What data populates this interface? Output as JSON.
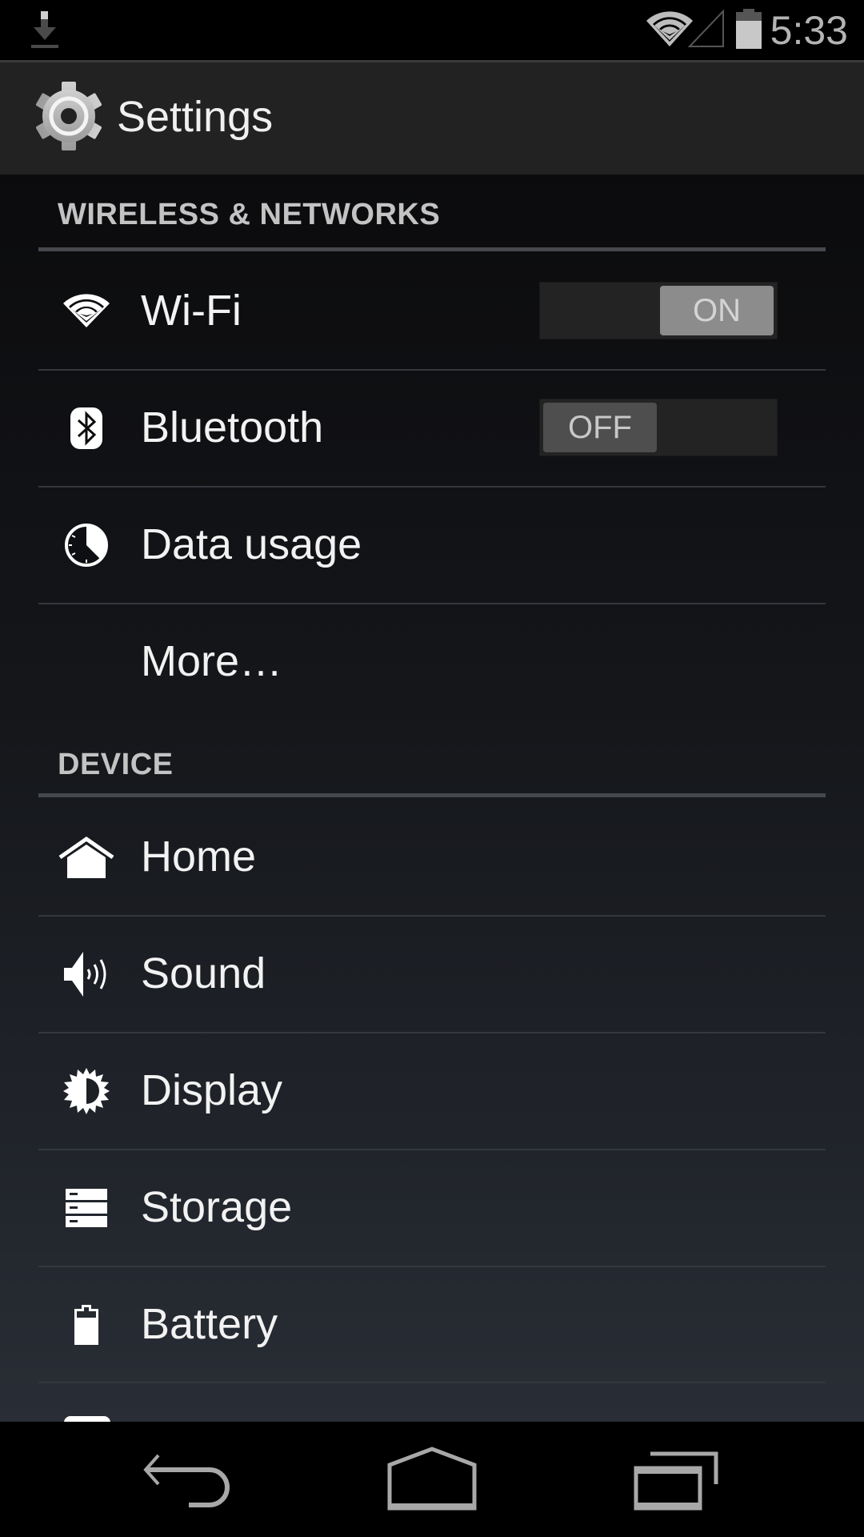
{
  "status_bar": {
    "time": "5:33",
    "icons": [
      "download-icon",
      "wifi-signal-icon",
      "cell-signal-icon",
      "battery-icon"
    ]
  },
  "action_bar": {
    "icon": "gear-icon",
    "title": "Settings"
  },
  "sections": [
    {
      "header": "WIRELESS & NETWORKS",
      "items": [
        {
          "label": "Wi-Fi",
          "icon": "wifi-icon",
          "toggle": "ON"
        },
        {
          "label": "Bluetooth",
          "icon": "bluetooth-icon",
          "toggle": "OFF"
        },
        {
          "label": "Data usage",
          "icon": "data-usage-icon"
        },
        {
          "label": "More…"
        }
      ]
    },
    {
      "header": "DEVICE",
      "items": [
        {
          "label": "Home",
          "icon": "home-icon"
        },
        {
          "label": "Sound",
          "icon": "sound-icon"
        },
        {
          "label": "Display",
          "icon": "display-icon"
        },
        {
          "label": "Storage",
          "icon": "storage-icon"
        },
        {
          "label": "Battery",
          "icon": "battery-icon"
        }
      ]
    }
  ],
  "nav_bar": {
    "buttons": [
      "back-icon",
      "home-icon",
      "recent-apps-icon"
    ]
  }
}
